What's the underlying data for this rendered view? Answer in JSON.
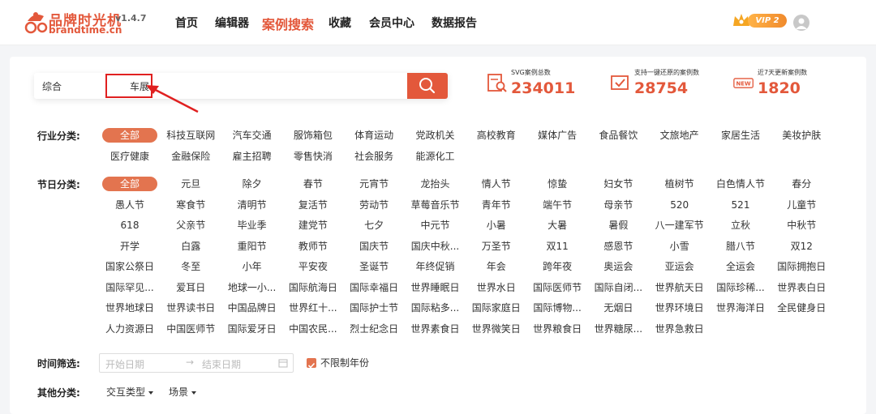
{
  "header": {
    "logo_cn": "品牌时光机",
    "logo_en": "brandtime.cn",
    "version": "v1.4.7",
    "nav": [
      "首页",
      "编辑器",
      "案例搜索",
      "收藏",
      "会员中心",
      "数据报告"
    ],
    "active_nav": "案例搜索",
    "vip_label": "VIP 2"
  },
  "search": {
    "type_label": "综合",
    "query": "车展"
  },
  "stats": [
    {
      "label": "SVG案例总数",
      "value": "234011",
      "icon": "search-doc-icon"
    },
    {
      "label": "支持一键还原的案例数",
      "value": "28754",
      "icon": "restore-icon"
    },
    {
      "label": "近7天更新案例数",
      "value": "1820",
      "icon": "new-badge-icon"
    }
  ],
  "filters": {
    "industry_label": "行业分类:",
    "industry_tags": [
      "全部",
      "科技互联网",
      "汽车交通",
      "服饰箱包",
      "体育运动",
      "党政机关",
      "高校教育",
      "媒体广告",
      "食品餐饮",
      "文旅地产",
      "家居生活",
      "美妆护肤",
      "医疗健康",
      "金融保险",
      "雇主招聘",
      "零售快消",
      "社会服务",
      "能源化工"
    ],
    "festival_label": "节日分类:",
    "festival_tags": [
      "全部",
      "元旦",
      "除夕",
      "春节",
      "元宵节",
      "龙抬头",
      "情人节",
      "惊蛰",
      "妇女节",
      "植树节",
      "白色情人节",
      "春分",
      "愚人节",
      "寒食节",
      "清明节",
      "复活节",
      "劳动节",
      "草莓音乐节",
      "青年节",
      "端午节",
      "母亲节",
      "520",
      "521",
      "儿童节",
      "618",
      "父亲节",
      "毕业季",
      "建党节",
      "七夕",
      "中元节",
      "小暑",
      "大暑",
      "暑假",
      "八一建军节",
      "立秋",
      "中秋节",
      "开学",
      "白露",
      "重阳节",
      "教师节",
      "国庆节",
      "国庆中秋...",
      "万圣节",
      "双11",
      "感恩节",
      "小雪",
      "腊八节",
      "双12",
      "国家公祭日",
      "冬至",
      "小年",
      "平安夜",
      "圣诞节",
      "年终促销",
      "年会",
      "跨年夜",
      "奥运会",
      "亚运会",
      "全运会",
      "国际拥抱日",
      "国际罕见...",
      "爱耳日",
      "地球一小...",
      "国际航海日",
      "国际幸福日",
      "世界睡眠日",
      "世界水日",
      "国际医师节",
      "国际自闭...",
      "世界航天日",
      "国际珍稀...",
      "世界表白日",
      "世界地球日",
      "世界读书日",
      "中国品牌日",
      "世界红十...",
      "国际护士节",
      "国际粘多...",
      "国际家庭日",
      "国际博物...",
      "无烟日",
      "世界环境日",
      "世界海洋日",
      "全民健身日",
      "人力资源日",
      "中国医师节",
      "国际爱牙日",
      "中国农民...",
      "烈士纪念日",
      "世界素食日",
      "世界微笑日",
      "世界粮食日",
      "世界糖尿...",
      "世界急救日"
    ],
    "time_label": "时间筛选:",
    "date_start_placeholder": "开始日期",
    "date_arrow": "→",
    "date_end_placeholder": "结束日期",
    "no_limit_year": "不限制年份",
    "other_label": "其他分类:",
    "interaction_type": "交互类型",
    "scene": "场景"
  }
}
